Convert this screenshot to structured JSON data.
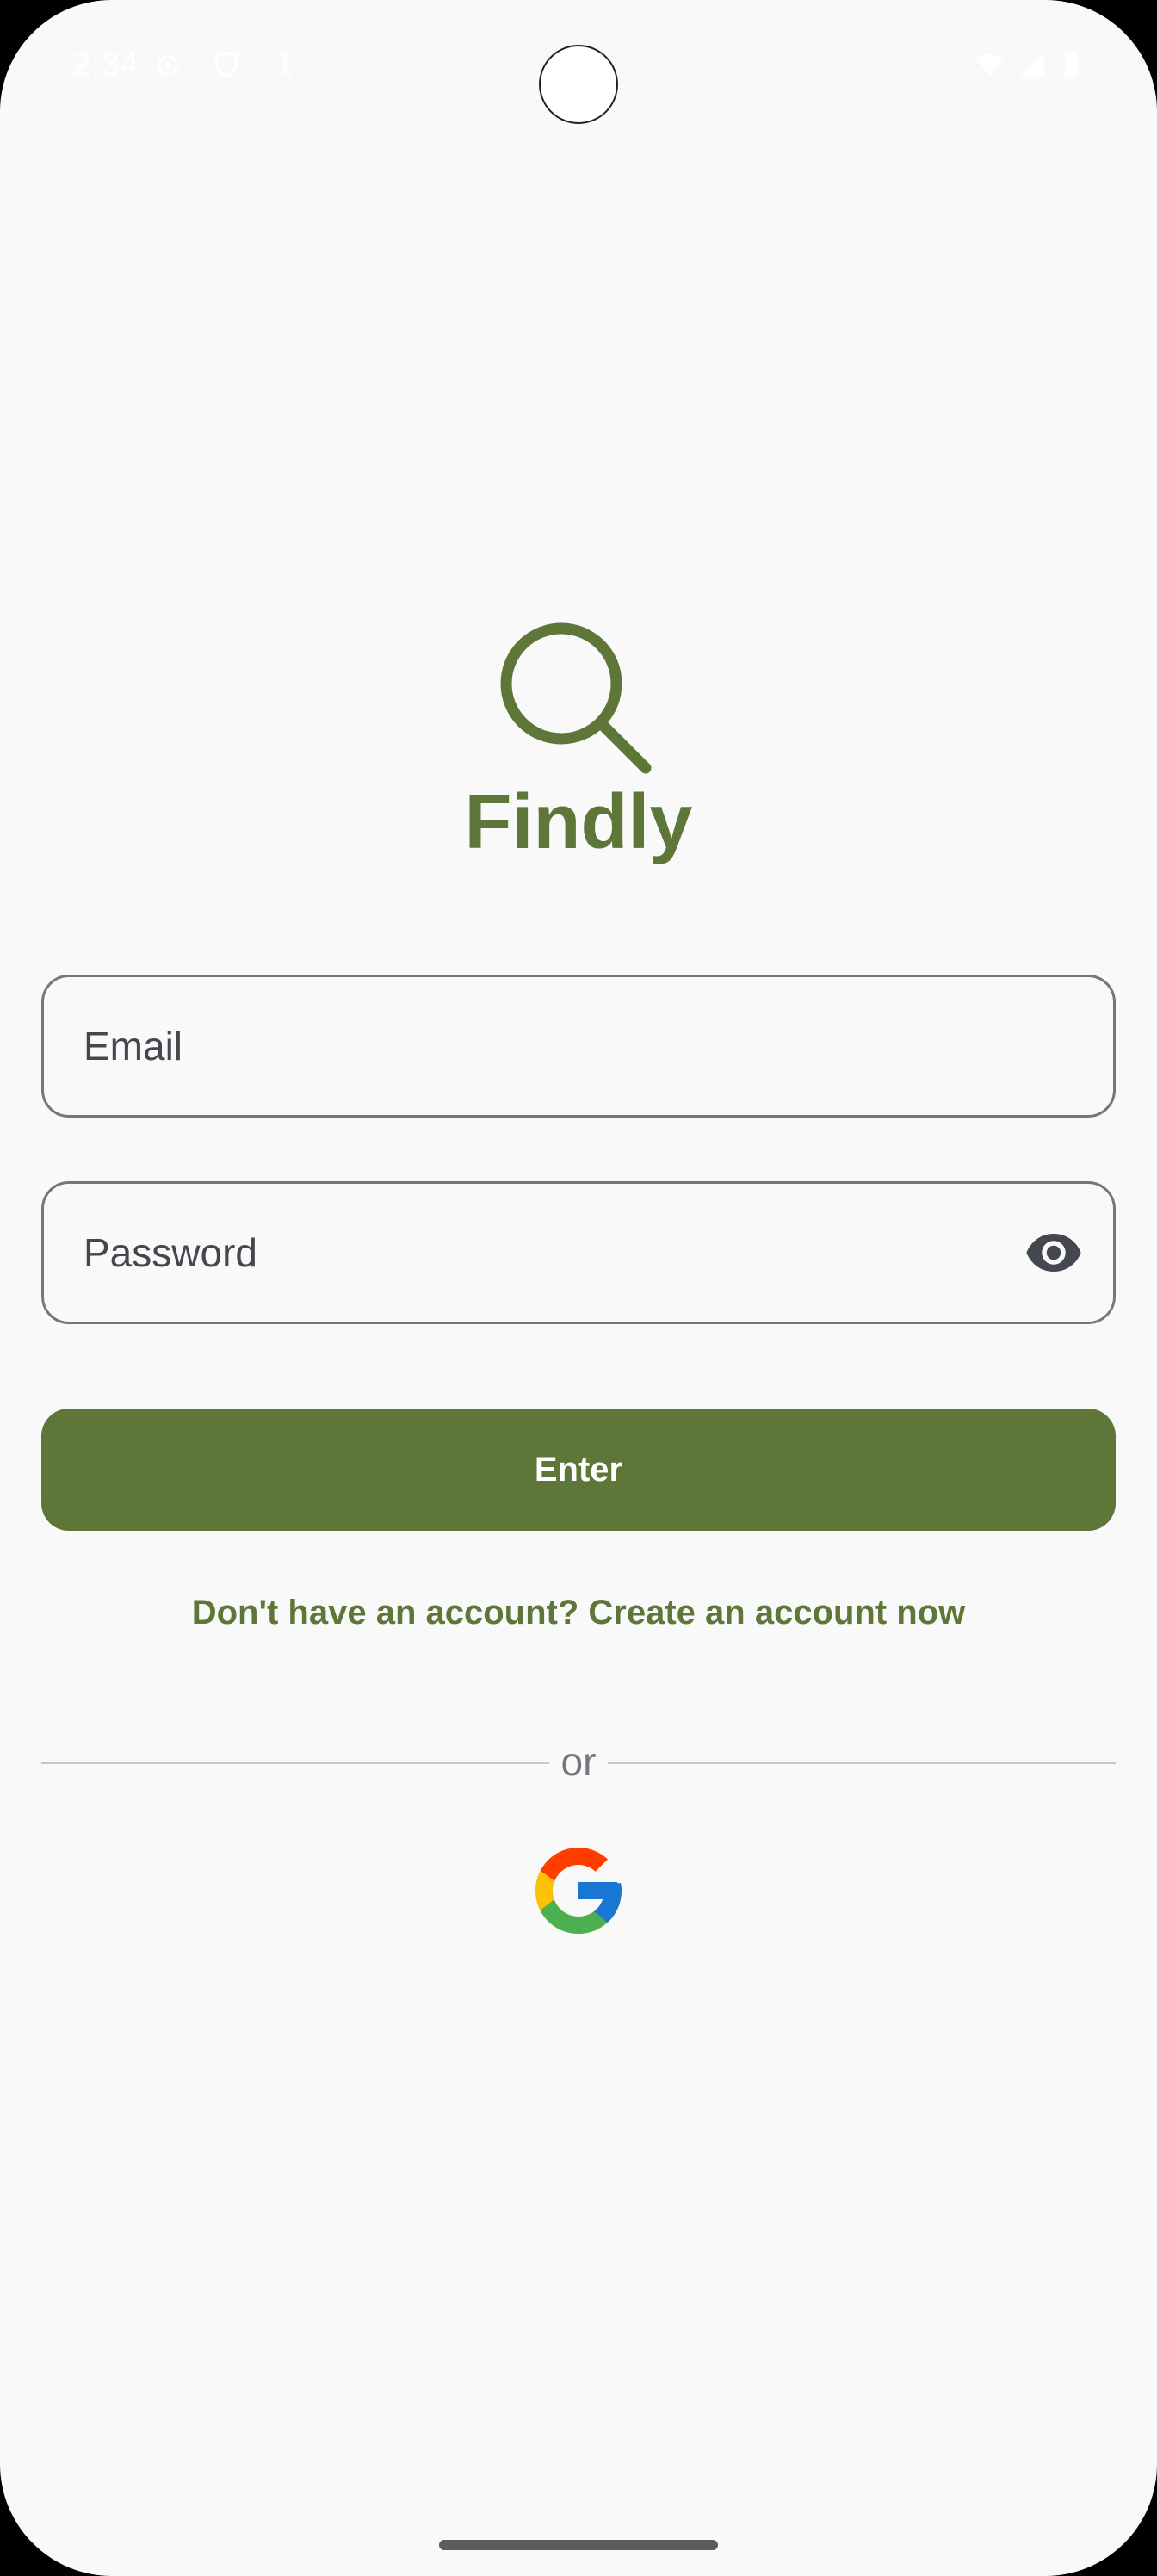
{
  "status_bar": {
    "time": "2:34",
    "icons": [
      "settings-icon",
      "shield-icon",
      "accessibility-icon",
      "wifi-icon",
      "signal-icon",
      "battery-icon"
    ]
  },
  "logo": {
    "icon": "magnifier-icon",
    "title": "Findly"
  },
  "form": {
    "email_placeholder": "Email",
    "password_placeholder": "Password",
    "password_toggle_icon": "eye-icon",
    "enter_label": "Enter"
  },
  "signup": {
    "text": "Don't have an account? Create an account now"
  },
  "divider": {
    "text": "or"
  },
  "social": {
    "google_icon": "google-icon"
  },
  "colors": {
    "brand": "#5f7639",
    "background": "#f9f9f9",
    "outline": "#74777f",
    "on_surface_variant": "#44474e"
  }
}
